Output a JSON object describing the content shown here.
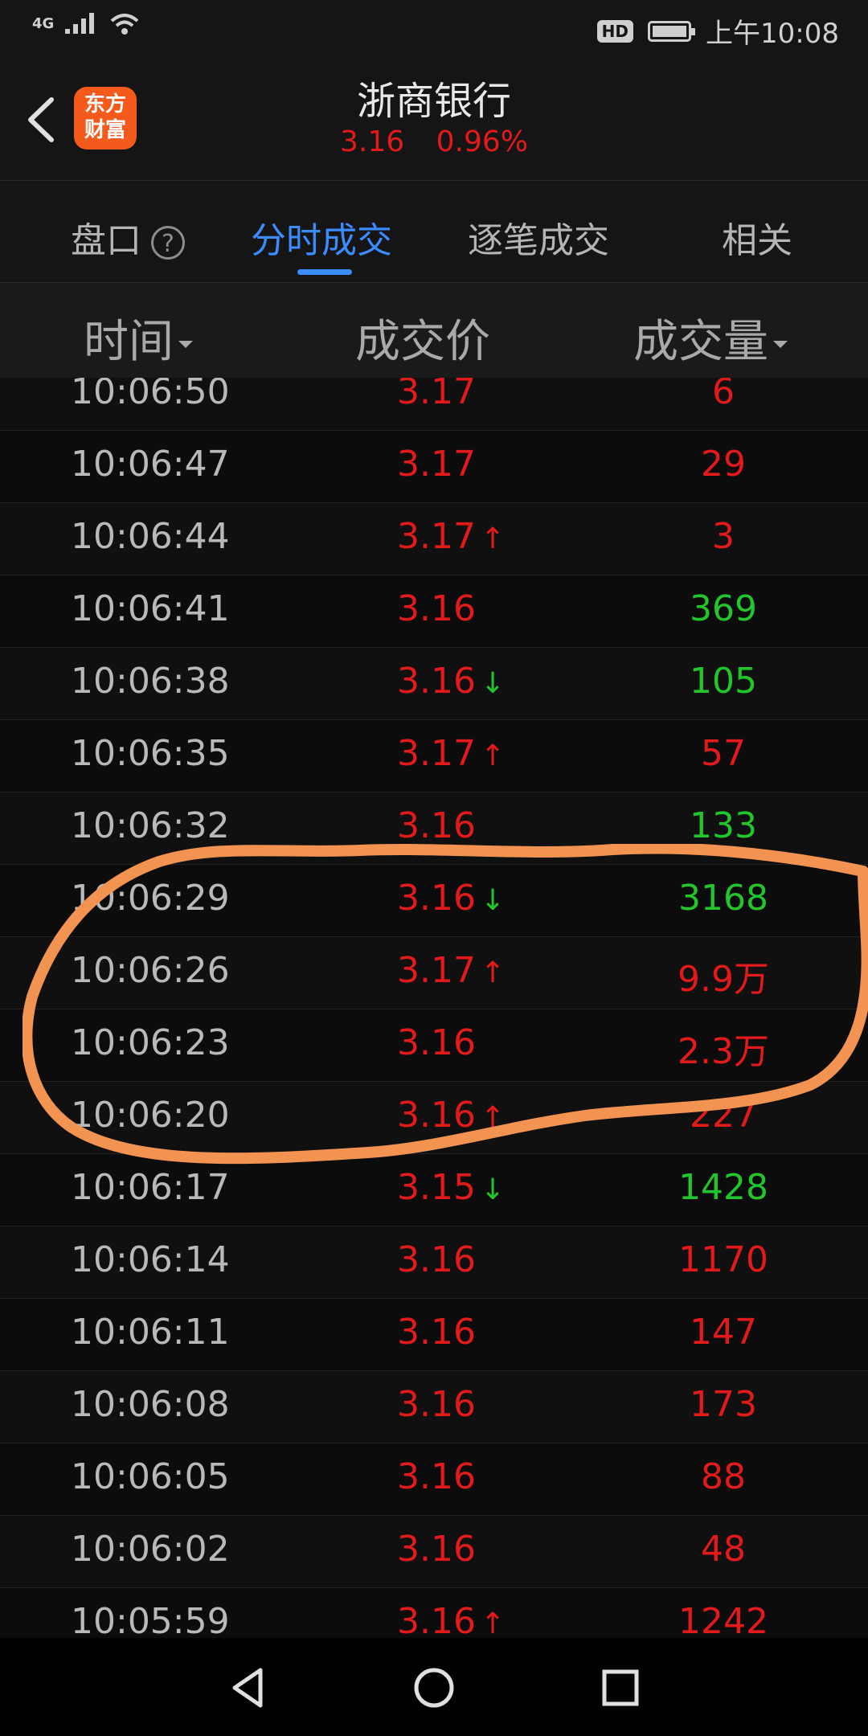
{
  "statusbar": {
    "network": "4G",
    "time": "上午10:08",
    "hd": "HD"
  },
  "header": {
    "logo_line1": "东方",
    "logo_line2": "财富",
    "stock_name": "浙商银行",
    "price": "3.16",
    "change_pct": "0.96%"
  },
  "tabs": [
    {
      "label": "盘口",
      "active": false
    },
    {
      "label": "分时成交",
      "active": true
    },
    {
      "label": "逐笔成交",
      "active": false
    },
    {
      "label": "相关",
      "active": false
    }
  ],
  "help_glyph": "?",
  "columns": {
    "time": "时间",
    "price": "成交价",
    "volume": "成交量"
  },
  "trades": [
    {
      "time": "10:06:50",
      "price": "3.17",
      "arrow": "",
      "volume": "6",
      "vol_color": "red"
    },
    {
      "time": "10:06:47",
      "price": "3.17",
      "arrow": "",
      "volume": "29",
      "vol_color": "red"
    },
    {
      "time": "10:06:44",
      "price": "3.17",
      "arrow": "↑",
      "volume": "3",
      "vol_color": "red"
    },
    {
      "time": "10:06:41",
      "price": "3.16",
      "arrow": "",
      "volume": "369",
      "vol_color": "green"
    },
    {
      "time": "10:06:38",
      "price": "3.16",
      "arrow": "↓",
      "volume": "105",
      "vol_color": "green"
    },
    {
      "time": "10:06:35",
      "price": "3.17",
      "arrow": "↑",
      "volume": "57",
      "vol_color": "red"
    },
    {
      "time": "10:06:32",
      "price": "3.16",
      "arrow": "",
      "volume": "133",
      "vol_color": "green"
    },
    {
      "time": "10:06:29",
      "price": "3.16",
      "arrow": "↓",
      "volume": "3168",
      "vol_color": "green"
    },
    {
      "time": "10:06:26",
      "price": "3.17",
      "arrow": "↑",
      "volume": "9.9万",
      "vol_color": "red"
    },
    {
      "time": "10:06:23",
      "price": "3.16",
      "arrow": "",
      "volume": "2.3万",
      "vol_color": "red"
    },
    {
      "time": "10:06:20",
      "price": "3.16",
      "arrow": "↑",
      "volume": "227",
      "vol_color": "red"
    },
    {
      "time": "10:06:17",
      "price": "3.15",
      "arrow": "↓",
      "volume": "1428",
      "vol_color": "green"
    },
    {
      "time": "10:06:14",
      "price": "3.16",
      "arrow": "",
      "volume": "1170",
      "vol_color": "red"
    },
    {
      "time": "10:06:11",
      "price": "3.16",
      "arrow": "",
      "volume": "147",
      "vol_color": "red"
    },
    {
      "time": "10:06:08",
      "price": "3.16",
      "arrow": "",
      "volume": "173",
      "vol_color": "red"
    },
    {
      "time": "10:06:05",
      "price": "3.16",
      "arrow": "",
      "volume": "88",
      "vol_color": "red"
    },
    {
      "time": "10:06:02",
      "price": "3.16",
      "arrow": "",
      "volume": "48",
      "vol_color": "red"
    },
    {
      "time": "10:05:59",
      "price": "3.16",
      "arrow": "↑",
      "volume": "1242",
      "vol_color": "red"
    }
  ],
  "colors": {
    "up": "#e21a1a",
    "down": "#22c52a",
    "accent": "#3b8cff",
    "annotation": "#f39352"
  },
  "icons": {
    "back": "chevron-left-icon",
    "nav_back": "triangle-back-icon",
    "nav_home": "circle-home-icon",
    "nav_recent": "square-recent-icon"
  }
}
